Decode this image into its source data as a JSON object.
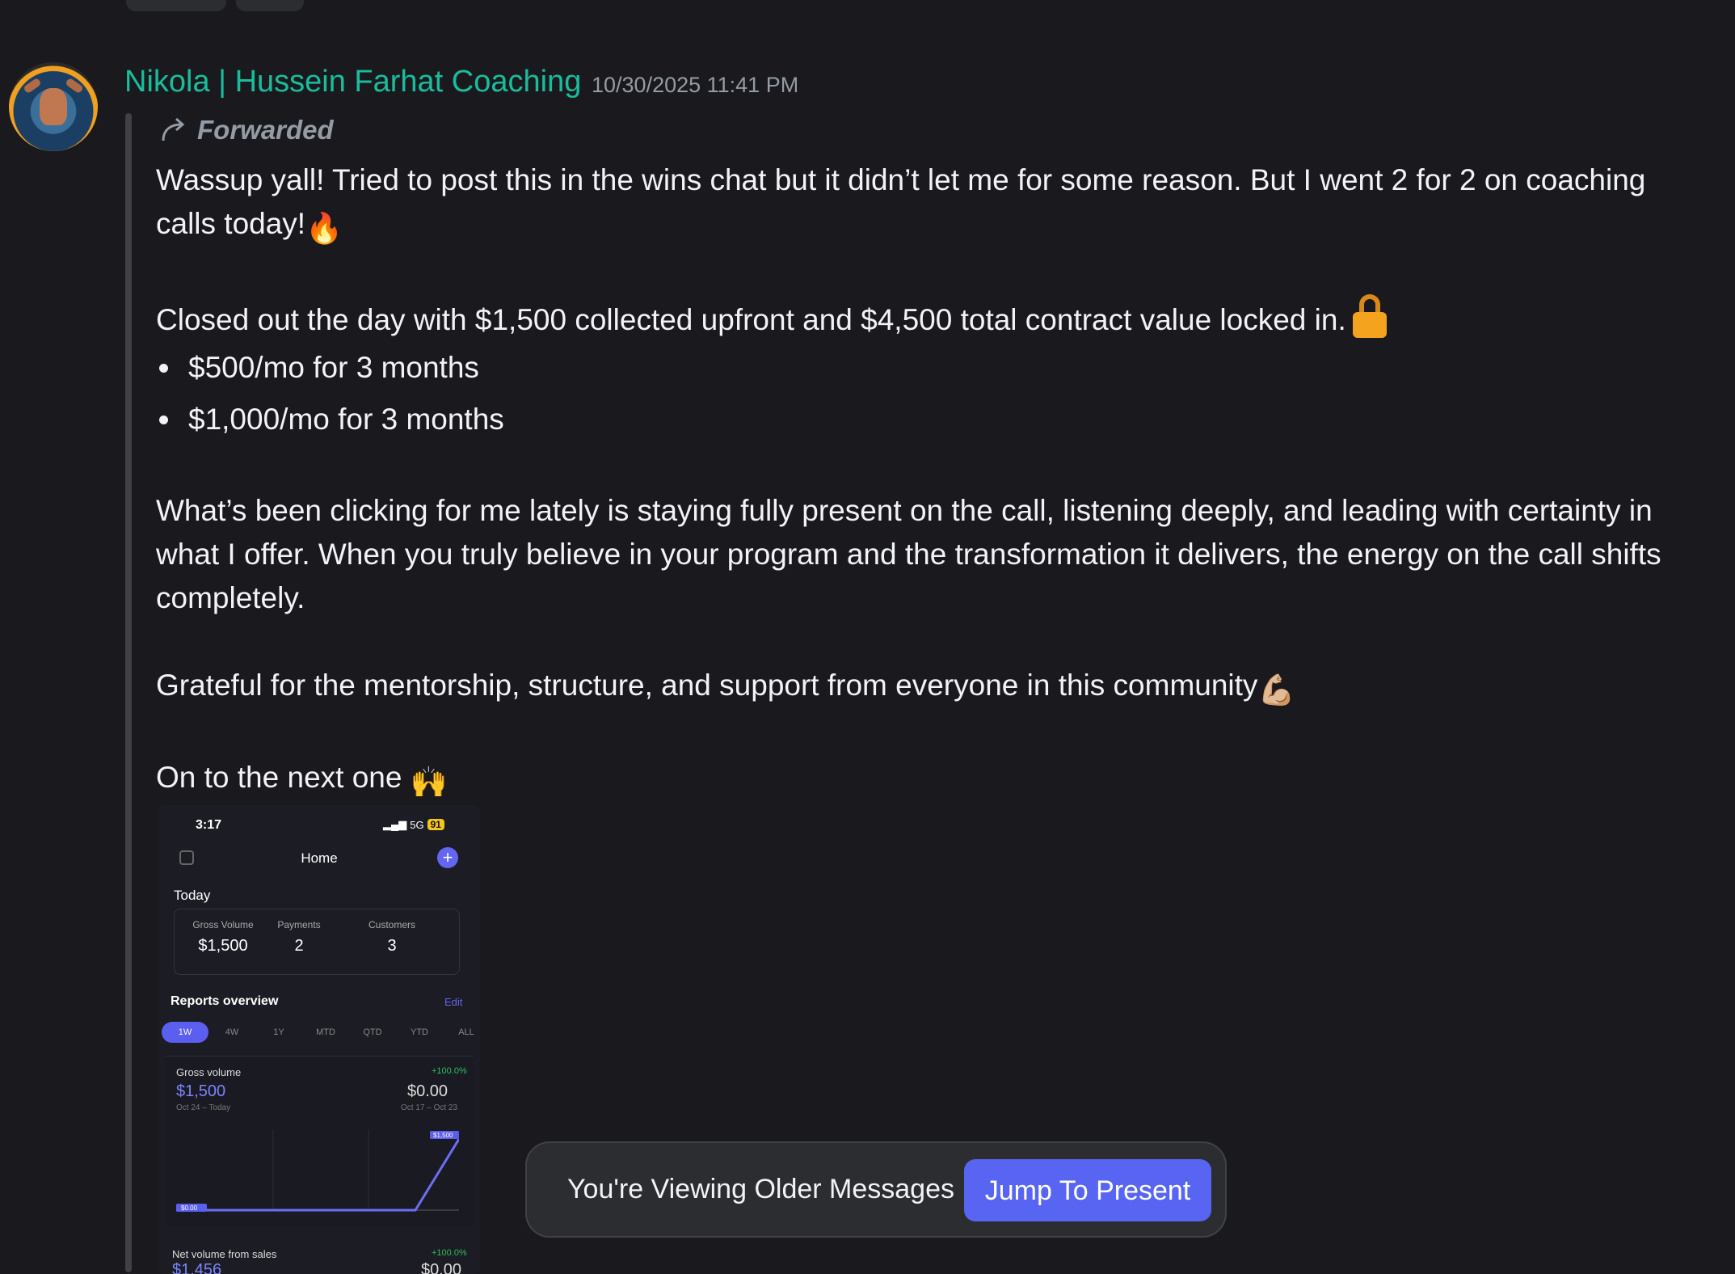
{
  "message": {
    "author": "Nikola | Hussein Farhat Coaching",
    "timestamp": "10/30/2025 11:41 PM",
    "forwarded_label": "Forwarded",
    "paragraph1": "Wassup yall! Tried to post this in the wins chat but it didn’t let me for some reason. But I went 2 for 2 on coaching calls today!",
    "paragraph2": "Closed out the day with $1,500 collected upfront and $4,500 total contract value locked in.",
    "bullets": [
      "$500/mo for 3 months",
      "$1,000/mo for 3 months"
    ],
    "paragraph3": "What’s been clicking for me lately is staying fully present on the call, listening deeply, and leading with certainty in what I offer. When you truly believe in your program and the transformation it delivers, the energy on the call shifts completely.",
    "paragraph4": "Grateful for the mentorship, structure, and support from everyone in this community",
    "paragraph5": "On to the next one",
    "emoji": {
      "fire": "🔥",
      "muscle": "💪🏼",
      "raised_hands": "🙌"
    }
  },
  "attachment": {
    "status_time": "3:17",
    "signal": "5G",
    "battery": "91",
    "title": "Home",
    "today_label": "Today",
    "stats": [
      {
        "label": "Gross Volume",
        "value": "$1,500"
      },
      {
        "label": "Payments",
        "value": "2"
      },
      {
        "label": "Customers",
        "value": "3"
      }
    ],
    "reports_label": "Reports overview",
    "edit_label": "Edit",
    "periods": [
      "1W",
      "4W",
      "1Y",
      "MTD",
      "QTD",
      "YTD",
      "ALL"
    ],
    "gross": {
      "label": "Gross volume",
      "delta": "+100.0%",
      "value": "$1,500",
      "prev_value": "$0.00",
      "range": "Oct 24 – Today",
      "prev_range": "Oct 17 – Oct 23",
      "end_tag": "$1,500",
      "start_tag": "$0.00"
    },
    "net": {
      "label": "Net volume from sales",
      "delta": "+100.0%",
      "value": "$1,456",
      "prev_value": "$0.00"
    }
  },
  "banner": {
    "text": "You're Viewing Older Messages",
    "button": "Jump To Present"
  },
  "colors": {
    "author": "#1abc9c",
    "accent": "#5865f2",
    "background": "#1a1a1e"
  }
}
